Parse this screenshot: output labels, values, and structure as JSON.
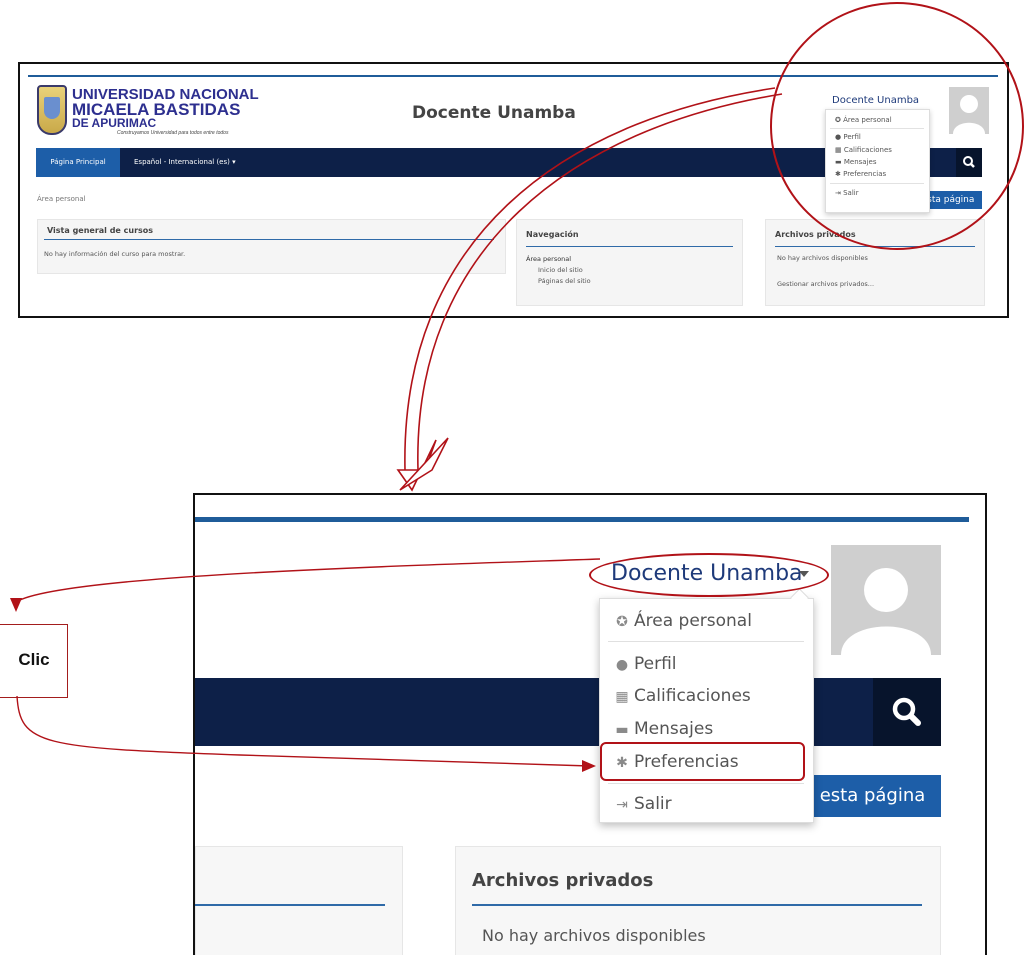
{
  "top": {
    "logo": {
      "line1": "UNIVERSIDAD NACIONAL",
      "line2": "MICAELA BASTIDAS",
      "line3": "DE APURIMAC",
      "tagline": "Construyamos Universidad para todos entre todos"
    },
    "site_title": "Docente Unamba",
    "user_name": "Docente Unamba",
    "nav": {
      "home": "Página Principal",
      "language": "Español - Internacional (es) ▾"
    },
    "breadcrumb": "Área personal",
    "page_button": "esta página",
    "courses_panel": {
      "title": "Vista general de cursos",
      "text": "No hay información del curso para mostrar."
    },
    "navigation_panel": {
      "title": "Navegación",
      "item1": "Área personal",
      "item2": "Inicio del sitio",
      "item3": "Páginas del sitio"
    },
    "files_panel": {
      "title": "Archivos privados",
      "text1": "No hay archivos disponibles",
      "text2": "Gestionar archivos privados..."
    },
    "menu": {
      "area": "Área personal",
      "profile": "Perfil",
      "grades": "Calificaciones",
      "messages": "Mensajes",
      "prefs": "Preferencias",
      "logout": "Salir"
    }
  },
  "zoom": {
    "user_name": "Docente Unamba",
    "menu": {
      "area": "Área personal",
      "profile": "Perfil",
      "grades": "Calificaciones",
      "messages": "Mensajes",
      "prefs": "Preferencias",
      "logout": "Salir"
    },
    "page_button": "esta página",
    "files_title": "Archivos privados",
    "files_text": "No hay archivos disponibles"
  },
  "annotation": {
    "label": "Clic"
  },
  "icons": {
    "area": "dashboard-icon",
    "profile": "user-icon",
    "grades": "table-icon",
    "messages": "chat-icon",
    "prefs": "gear-icon",
    "logout": "sign-out-icon",
    "search": "search-icon"
  },
  "colors": {
    "accent": "#1d5ea8",
    "navbar": "#0d2048",
    "annotation": "#b11218"
  }
}
